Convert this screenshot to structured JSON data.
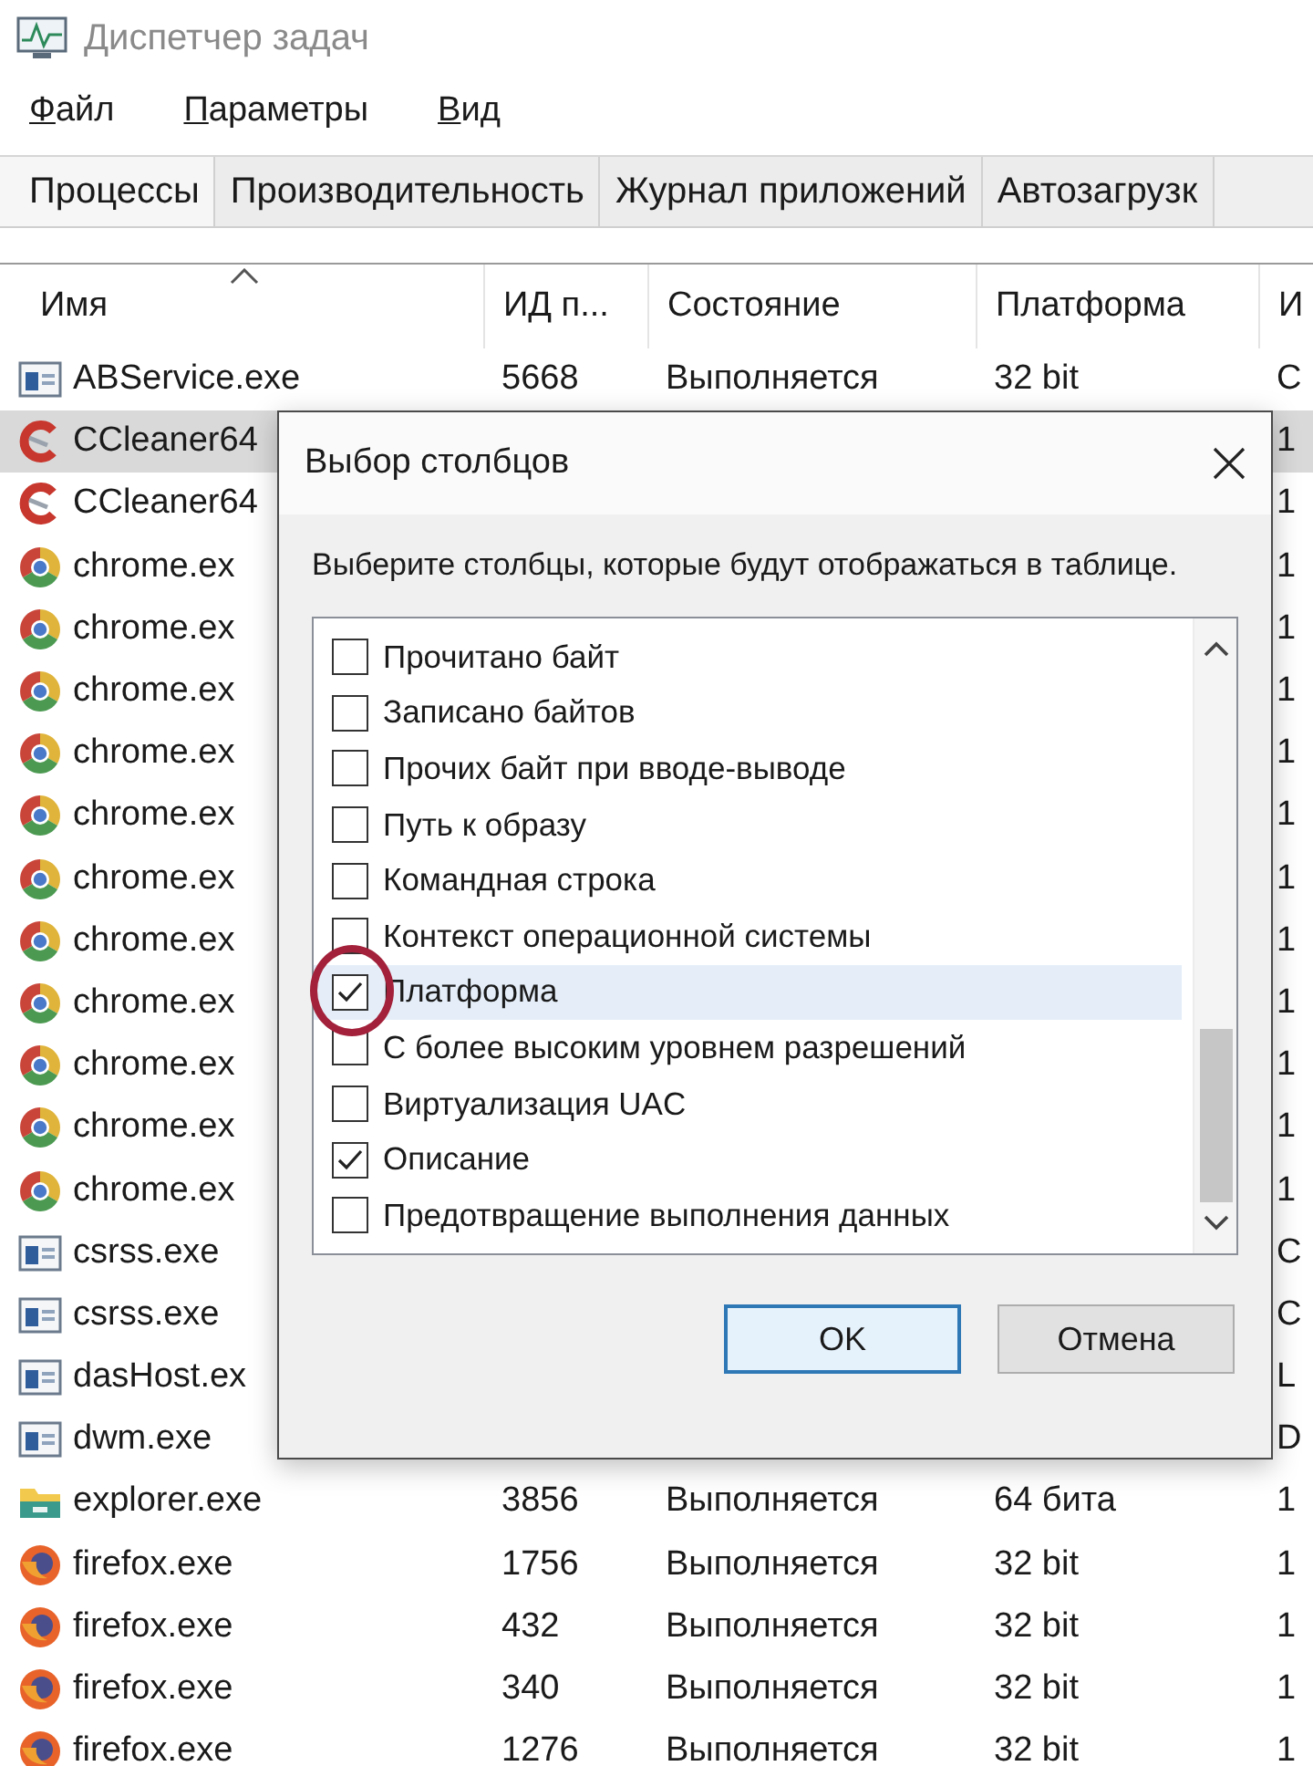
{
  "window": {
    "title": "Диспетчер задач"
  },
  "menu": [
    "Файл",
    "Параметры",
    "Вид"
  ],
  "tabs": [
    {
      "label": "Процессы",
      "selected": true
    },
    {
      "label": "Производительность",
      "selected": false
    },
    {
      "label": "Журнал приложений",
      "selected": false
    },
    {
      "label": "Автозагрузк",
      "selected": false
    }
  ],
  "table": {
    "columns": [
      "Имя",
      "ИД п...",
      "Состояние",
      "Платформа",
      "И"
    ],
    "rows": [
      {
        "kind": "window",
        "name": "ABService.exe",
        "pid": "5668",
        "state": "Выполняется",
        "platform": "32 bit",
        "column_5": "C",
        "selected": false
      },
      {
        "kind": "ccleaner",
        "name": "CCleaner64",
        "column_5": "1",
        "selected": true
      },
      {
        "kind": "ccleaner",
        "name": "CCleaner64",
        "column_5": "1",
        "selected": false
      },
      {
        "kind": "chrome",
        "name": "chrome.ex",
        "column_5": "1",
        "selected": false
      },
      {
        "kind": "chrome",
        "name": "chrome.ex",
        "column_5": "1",
        "selected": false
      },
      {
        "kind": "chrome",
        "name": "chrome.ex",
        "column_5": "1",
        "selected": false
      },
      {
        "kind": "chrome",
        "name": "chrome.ex",
        "column_5": "1",
        "selected": false
      },
      {
        "kind": "chrome",
        "name": "chrome.ex",
        "column_5": "1",
        "selected": false
      },
      {
        "kind": "chrome",
        "name": "chrome.ex",
        "column_5": "1",
        "selected": false
      },
      {
        "kind": "chrome",
        "name": "chrome.ex",
        "column_5": "1",
        "selected": false
      },
      {
        "kind": "chrome",
        "name": "chrome.ex",
        "column_5": "1",
        "selected": false
      },
      {
        "kind": "chrome",
        "name": "chrome.ex",
        "column_5": "1",
        "selected": false
      },
      {
        "kind": "chrome",
        "name": "chrome.ex",
        "column_5": "1",
        "selected": false
      },
      {
        "kind": "chrome",
        "name": "chrome.ex",
        "column_5": "1",
        "selected": false
      },
      {
        "kind": "window",
        "name": "csrss.exe",
        "column_5": "C",
        "selected": false
      },
      {
        "kind": "window",
        "name": "csrss.exe",
        "column_5": "C",
        "selected": false
      },
      {
        "kind": "window",
        "name": "dasHost.ex",
        "column_5": "L",
        "selected": false
      },
      {
        "kind": "window",
        "name": "dwm.exe",
        "column_5": "D",
        "selected": false
      },
      {
        "kind": "explorer",
        "name": "explorer.exe",
        "pid": "3856",
        "state": "Выполняется",
        "platform": "64 бита",
        "column_5": "1",
        "selected": false
      },
      {
        "kind": "firefox",
        "name": "firefox.exe",
        "pid": "1756",
        "state": "Выполняется",
        "platform": "32 bit",
        "column_5": "1",
        "selected": false
      },
      {
        "kind": "firefox",
        "name": "firefox.exe",
        "pid": "432",
        "state": "Выполняется",
        "platform": "32 bit",
        "column_5": "1",
        "selected": false
      },
      {
        "kind": "firefox",
        "name": "firefox.exe",
        "pid": "340",
        "state": "Выполняется",
        "platform": "32 bit",
        "column_5": "1",
        "selected": false
      },
      {
        "kind": "firefox",
        "name": "firefox.exe",
        "pid": "1276",
        "state": "Выполняется",
        "platform": "32 bit",
        "column_5": "1",
        "selected": false
      }
    ]
  },
  "dialog": {
    "title": "Выбор столбцов",
    "description": "Выберите столбцы, которые будут отображаться в таблице.",
    "items": [
      {
        "label": "Прочитано байт",
        "checked": false,
        "selected": false
      },
      {
        "label": "Записано байтов",
        "checked": false,
        "selected": false
      },
      {
        "label": "Прочих байт при вводе-выводе",
        "checked": false,
        "selected": false
      },
      {
        "label": "Путь к образу",
        "checked": false,
        "selected": false
      },
      {
        "label": "Командная строка",
        "checked": false,
        "selected": false
      },
      {
        "label": "Контекст операционной системы",
        "checked": false,
        "selected": false
      },
      {
        "label": "Платформа",
        "checked": true,
        "selected": true
      },
      {
        "label": "С более высоким уровнем разрешений",
        "checked": false,
        "selected": false
      },
      {
        "label": "Виртуализация UAC",
        "checked": false,
        "selected": false
      },
      {
        "label": "Описание",
        "checked": true,
        "selected": false
      },
      {
        "label": "Предотвращение выполнения данных",
        "checked": false,
        "selected": false
      }
    ],
    "buttons": [
      "OK",
      "Отмена"
    ]
  }
}
